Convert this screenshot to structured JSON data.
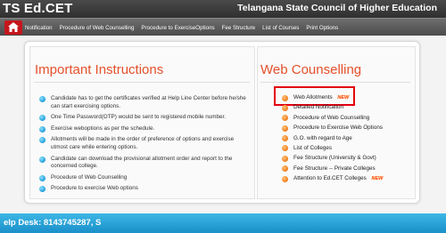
{
  "header": {
    "brand": "TS Ed.CET",
    "council": "Telangana State Council of Higher Education"
  },
  "nav": {
    "home_icon": "home-icon",
    "items": [
      "Notification",
      "Procedure of Web Counselling",
      "Procedure to ExerciseOptions",
      "Fee Structure",
      "List of Courses",
      "Print Options"
    ]
  },
  "instructions": {
    "title": "Important Instructions",
    "items": [
      "Candidate has to get the certificates verified at Help Line Center before he/she can start exercising options.",
      "One Time Password(OTP) would be sent to registered mobile number.",
      "Exercise weboptions as per the schedule.",
      "Allotments will be made in the order of preference of options and exercise utmost care while entering options.",
      "Candidate can download the provisional allotment order and report to the concerned college.",
      "Procedure of Web Counselling",
      "Procedure to exercise Web options"
    ]
  },
  "web_counselling": {
    "title": "Web Counselling",
    "new_badge": "NEW",
    "items": [
      "Web Allotments",
      "Detailed Notification",
      "Procedure of Web Counselling",
      "Procedure to Exercise Web Options",
      "G.O. with regard to Age",
      "List of Colleges",
      "Fee Structure (University & Govt)",
      "Fee Structure -- Private Colleges",
      "Attention to Ed.CET Colleges"
    ]
  },
  "footer": {
    "helpdesk": "elp Desk: 8143745287,   S"
  },
  "colors": {
    "accent_title": "#e4502a",
    "highlight_box": "#e3000f",
    "footer_bar": "#1a8fc9",
    "home_button": "#c4161c"
  }
}
